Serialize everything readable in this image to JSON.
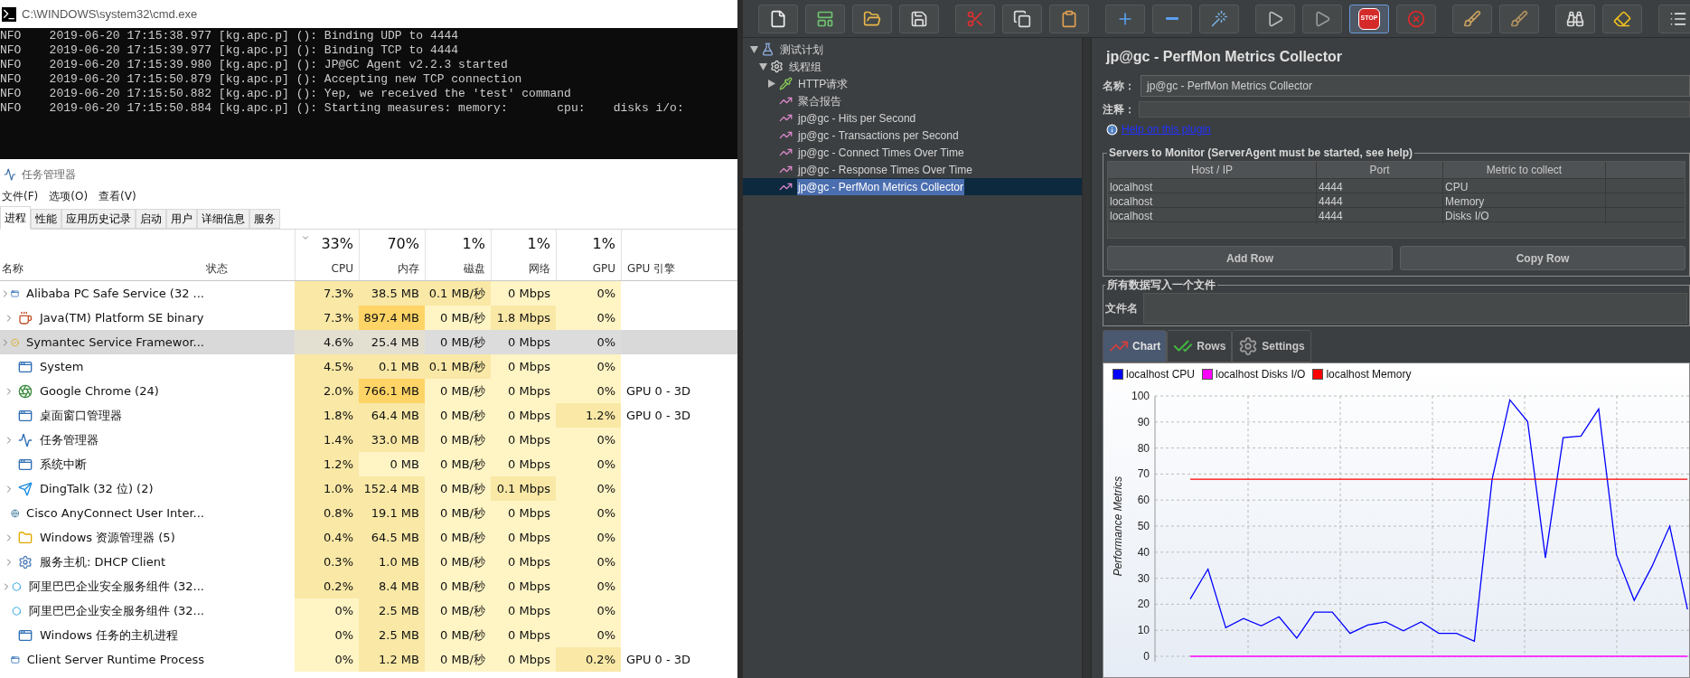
{
  "cmd": {
    "title": "C:\\WINDOWS\\system32\\cmd.exe",
    "lines": [
      "NFO    2019-06-20 17:15:38.977 [kg.apc.p] (): Binding UDP to 4444",
      "NFO    2019-06-20 17:15:39.977 [kg.apc.p] (): Binding TCP to 4444",
      "NFO    2019-06-20 17:15:39.980 [kg.apc.p] (): JP@GC Agent v2.2.3 started",
      "NFO    2019-06-20 17:15:50.879 [kg.apc.p] (): Accepting new TCP connection",
      "NFO    2019-06-20 17:15:50.882 [kg.apc.p] (): Yep, we received the 'test' command",
      "NFO    2019-06-20 17:15:50.884 [kg.apc.p] (): Starting measures: memory:       cpu:    disks i/o:"
    ]
  },
  "task_manager": {
    "title": "任务管理器",
    "menu": [
      "文件(F)",
      "选项(O)",
      "查看(V)"
    ],
    "tabs": [
      {
        "label": "进程",
        "selected": true
      },
      {
        "label": "性能",
        "selected": false
      },
      {
        "label": "应用历史记录",
        "selected": false
      },
      {
        "label": "启动",
        "selected": false
      },
      {
        "label": "用户",
        "selected": false
      },
      {
        "label": "详细信息",
        "selected": false
      },
      {
        "label": "服务",
        "selected": false
      }
    ],
    "columns": [
      {
        "kind": "text",
        "label": "名称"
      },
      {
        "kind": "text",
        "label": "状态"
      },
      {
        "kind": "metric",
        "label": "CPU",
        "total": "33%",
        "sorted": true
      },
      {
        "kind": "metric",
        "label": "内存",
        "total": "70%",
        "sorted": false
      },
      {
        "kind": "metric",
        "label": "磁盘",
        "total": "1%",
        "sorted": false
      },
      {
        "kind": "metric",
        "label": "网络",
        "total": "1%",
        "sorted": false
      },
      {
        "kind": "metric",
        "label": "GPU",
        "total": "1%",
        "sorted": false
      },
      {
        "kind": "text",
        "label": "GPU 引擎"
      }
    ],
    "rows": [
      {
        "kind": "window",
        "expandable": true,
        "selected": false,
        "cells": [
          {
            "text": "Alibaba PC Safe Service (32 ..."
          },
          {
            "text": ""
          },
          {
            "text": "7.3%",
            "color": "#f9e8a6"
          },
          {
            "text": "38.5 MB",
            "color": "#f9e8a6"
          },
          {
            "text": "0.1 MB/秒",
            "color": "#f9e8a6"
          },
          {
            "text": "0 Mbps",
            "color": "#fff4c4"
          },
          {
            "text": "0%",
            "color": "#fff4c4"
          },
          {
            "text": ""
          }
        ]
      },
      {
        "kind": "java",
        "expandable": true,
        "selected": false,
        "cells": [
          {
            "text": "Java(TM) Platform SE binary"
          },
          {
            "text": ""
          },
          {
            "text": "7.3%",
            "color": "#f9e8a6"
          },
          {
            "text": "897.4 MB",
            "color": "#ffd466"
          },
          {
            "text": "0 MB/秒",
            "color": "#fff4c4"
          },
          {
            "text": "1.8 Mbps",
            "color": "#f9e8a6"
          },
          {
            "text": "0%",
            "color": "#fff4c4"
          },
          {
            "text": ""
          }
        ]
      },
      {
        "kind": "check",
        "expandable": true,
        "selected": true,
        "cells": [
          {
            "text": "Symantec Service Framewor..."
          },
          {
            "text": ""
          },
          {
            "text": "4.6%",
            "color": "#e3e0d2"
          },
          {
            "text": "25.4 MB",
            "color": "#e3e0d2"
          },
          {
            "text": "0 MB/秒",
            "color": "#dcdcdc"
          },
          {
            "text": "0 Mbps",
            "color": "#dcdcdc"
          },
          {
            "text": "0%",
            "color": "#dcdcdc"
          },
          {
            "text": ""
          }
        ]
      },
      {
        "kind": "window",
        "expandable": false,
        "selected": false,
        "cells": [
          {
            "text": "System"
          },
          {
            "text": ""
          },
          {
            "text": "4.5%",
            "color": "#f9e8a6"
          },
          {
            "text": "0.1 MB",
            "color": "#f9e8a6"
          },
          {
            "text": "0.1 MB/秒",
            "color": "#f9e8a6"
          },
          {
            "text": "0 Mbps",
            "color": "#fff4c4"
          },
          {
            "text": "0%",
            "color": "#fff4c4"
          },
          {
            "text": ""
          }
        ]
      },
      {
        "kind": "chrome",
        "expandable": true,
        "selected": false,
        "cells": [
          {
            "text": "Google Chrome (24)"
          },
          {
            "text": ""
          },
          {
            "text": "2.0%",
            "color": "#f9e8a6"
          },
          {
            "text": "766.1 MB",
            "color": "#ffd466"
          },
          {
            "text": "0 MB/秒",
            "color": "#fff4c4"
          },
          {
            "text": "0 Mbps",
            "color": "#fff4c4"
          },
          {
            "text": "0%",
            "color": "#fff4c4"
          },
          {
            "text": "GPU 0 - 3D"
          }
        ]
      },
      {
        "kind": "window",
        "expandable": false,
        "selected": false,
        "cells": [
          {
            "text": "桌面窗口管理器"
          },
          {
            "text": ""
          },
          {
            "text": "1.8%",
            "color": "#f9e8a6"
          },
          {
            "text": "64.4 MB",
            "color": "#f9e8a6"
          },
          {
            "text": "0 MB/秒",
            "color": "#fff4c4"
          },
          {
            "text": "0 Mbps",
            "color": "#fff4c4"
          },
          {
            "text": "1.2%",
            "color": "#f9e8a6"
          },
          {
            "text": "GPU 0 - 3D"
          }
        ]
      },
      {
        "kind": "monitor",
        "expandable": true,
        "selected": false,
        "cells": [
          {
            "text": "任务管理器"
          },
          {
            "text": ""
          },
          {
            "text": "1.4%",
            "color": "#f9e8a6"
          },
          {
            "text": "33.0 MB",
            "color": "#f9e8a6"
          },
          {
            "text": "0 MB/秒",
            "color": "#fff4c4"
          },
          {
            "text": "0 Mbps",
            "color": "#fff4c4"
          },
          {
            "text": "0%",
            "color": "#fff4c4"
          },
          {
            "text": ""
          }
        ]
      },
      {
        "kind": "window",
        "expandable": false,
        "selected": false,
        "cells": [
          {
            "text": "系统中断"
          },
          {
            "text": ""
          },
          {
            "text": "1.2%",
            "color": "#f9e8a6"
          },
          {
            "text": "0 MB",
            "color": "#fff4c4"
          },
          {
            "text": "0 MB/秒",
            "color": "#fff4c4"
          },
          {
            "text": "0 Mbps",
            "color": "#fff4c4"
          },
          {
            "text": "0%",
            "color": "#fff4c4"
          },
          {
            "text": ""
          }
        ]
      },
      {
        "kind": "bird",
        "expandable": true,
        "selected": false,
        "cells": [
          {
            "text": "DingTalk (32 位) (2)"
          },
          {
            "text": ""
          },
          {
            "text": "1.0%",
            "color": "#f9e8a6"
          },
          {
            "text": "152.4 MB",
            "color": "#f9e8a6"
          },
          {
            "text": "0 MB/秒",
            "color": "#fff4c4"
          },
          {
            "text": "0.1 Mbps",
            "color": "#f9e8a6"
          },
          {
            "text": "0%",
            "color": "#fff4c4"
          },
          {
            "text": ""
          }
        ]
      },
      {
        "kind": "globe",
        "expandable": false,
        "selected": false,
        "cells": [
          {
            "text": "Cisco AnyConnect User Inter..."
          },
          {
            "text": ""
          },
          {
            "text": "0.8%",
            "color": "#f9e8a6"
          },
          {
            "text": "19.1 MB",
            "color": "#f9e8a6"
          },
          {
            "text": "0 MB/秒",
            "color": "#fff4c4"
          },
          {
            "text": "0 Mbps",
            "color": "#fff4c4"
          },
          {
            "text": "0%",
            "color": "#fff4c4"
          },
          {
            "text": ""
          }
        ]
      },
      {
        "kind": "folder",
        "expandable": true,
        "selected": false,
        "cells": [
          {
            "text": "Windows 资源管理器 (5)"
          },
          {
            "text": ""
          },
          {
            "text": "0.4%",
            "color": "#f9e8a6"
          },
          {
            "text": "64.5 MB",
            "color": "#f9e8a6"
          },
          {
            "text": "0 MB/秒",
            "color": "#fff4c4"
          },
          {
            "text": "0 Mbps",
            "color": "#fff4c4"
          },
          {
            "text": "0%",
            "color": "#fff4c4"
          },
          {
            "text": ""
          }
        ]
      },
      {
        "kind": "gear",
        "expandable": true,
        "selected": false,
        "cells": [
          {
            "text": "服务主机: DHCP Client"
          },
          {
            "text": ""
          },
          {
            "text": "0.3%",
            "color": "#f9e8a6"
          },
          {
            "text": "1.0 MB",
            "color": "#f9e8a6"
          },
          {
            "text": "0 MB/秒",
            "color": "#fff4c4"
          },
          {
            "text": "0 Mbps",
            "color": "#fff4c4"
          },
          {
            "text": "0%",
            "color": "#fff4c4"
          },
          {
            "text": ""
          }
        ]
      },
      {
        "kind": "hexagon",
        "expandable": true,
        "selected": false,
        "cells": [
          {
            "text": "阿里巴巴企业安全服务组件 (32..."
          },
          {
            "text": ""
          },
          {
            "text": "0.2%",
            "color": "#f9e8a6"
          },
          {
            "text": "8.4 MB",
            "color": "#f9e8a6"
          },
          {
            "text": "0 MB/秒",
            "color": "#fff4c4"
          },
          {
            "text": "0 Mbps",
            "color": "#fff4c4"
          },
          {
            "text": "0%",
            "color": "#fff4c4"
          },
          {
            "text": ""
          }
        ]
      },
      {
        "kind": "hexagon",
        "expandable": false,
        "selected": false,
        "cells": [
          {
            "text": "阿里巴巴企业安全服务组件 (32..."
          },
          {
            "text": ""
          },
          {
            "text": "0%",
            "color": "#fff4c4"
          },
          {
            "text": "2.5 MB",
            "color": "#f9e8a6"
          },
          {
            "text": "0 MB/秒",
            "color": "#fff4c4"
          },
          {
            "text": "0 Mbps",
            "color": "#fff4c4"
          },
          {
            "text": "0%",
            "color": "#fff4c4"
          },
          {
            "text": ""
          }
        ]
      },
      {
        "kind": "window",
        "expandable": false,
        "selected": false,
        "cells": [
          {
            "text": "Windows 任务的主机进程"
          },
          {
            "text": ""
          },
          {
            "text": "0%",
            "color": "#fff4c4"
          },
          {
            "text": "2.5 MB",
            "color": "#f9e8a6"
          },
          {
            "text": "0 MB/秒",
            "color": "#fff4c4"
          },
          {
            "text": "0 Mbps",
            "color": "#fff4c4"
          },
          {
            "text": "0%",
            "color": "#fff4c4"
          },
          {
            "text": ""
          }
        ]
      },
      {
        "kind": "window",
        "expandable": false,
        "selected": false,
        "cells": [
          {
            "text": "Client Server Runtime Process"
          },
          {
            "text": ""
          },
          {
            "text": "0%",
            "color": "#fff4c4"
          },
          {
            "text": "1.2 MB",
            "color": "#f9e8a6"
          },
          {
            "text": "0 MB/秒",
            "color": "#fff4c4"
          },
          {
            "text": "0 Mbps",
            "color": "#fff4c4"
          },
          {
            "text": "0.2%",
            "color": "#f9e8a6"
          },
          {
            "text": "GPU 0 - 3D"
          }
        ]
      }
    ]
  },
  "jmeter": {
    "toolbar": [
      [
        {
          "kind": "new",
          "highlighted": false
        },
        {
          "kind": "templates",
          "highlighted": false
        },
        {
          "kind": "open",
          "highlighted": false
        },
        {
          "kind": "save",
          "highlighted": false
        }
      ],
      [
        {
          "kind": "cut",
          "highlighted": false
        },
        {
          "kind": "copy",
          "highlighted": false
        },
        {
          "kind": "paste",
          "highlighted": false
        }
      ],
      [
        {
          "kind": "expand",
          "highlighted": false
        },
        {
          "kind": "collapse",
          "highlighted": false
        },
        {
          "kind": "toggle",
          "highlighted": false
        }
      ],
      [
        {
          "kind": "start",
          "highlighted": false
        },
        {
          "kind": "start_no_pause",
          "highlighted": false
        },
        {
          "kind": "stop",
          "label": "STOP",
          "highlighted": true
        },
        {
          "kind": "shutdown",
          "highlighted": false
        }
      ],
      [
        {
          "kind": "clear",
          "highlighted": false
        },
        {
          "kind": "clear_all",
          "highlighted": false
        }
      ],
      [
        {
          "kind": "search",
          "highlighted": false
        },
        {
          "kind": "reset_search",
          "highlighted": false
        }
      ],
      [
        {
          "kind": "functions",
          "highlighted": false
        }
      ]
    ],
    "tree": [
      {
        "label": "测试计划",
        "kind": "plan",
        "expanded": true,
        "selected": false,
        "children": [
          {
            "label": "线程组",
            "kind": "threads",
            "expanded": true,
            "selected": false,
            "children": [
              {
                "label": "HTTP请求",
                "kind": "sampler",
                "expanded": false,
                "selected": false
              },
              {
                "label": "聚合报告",
                "kind": "listener",
                "selected": false
              },
              {
                "label": "jp@gc - Hits per Second",
                "kind": "listener",
                "selected": false
              },
              {
                "label": "jp@gc - Transactions per Second",
                "kind": "listener",
                "selected": false
              },
              {
                "label": "jp@gc - Connect Times Over Time",
                "kind": "listener",
                "selected": false
              },
              {
                "label": "jp@gc - Response Times Over Time",
                "kind": "listener",
                "selected": false
              },
              {
                "label": "jp@gc - PerfMon Metrics Collector",
                "kind": "listener",
                "selected": true
              }
            ]
          }
        ]
      }
    ],
    "title": "jp@gc - PerfMon Metrics Collector",
    "name_label": "名称：",
    "name_value": "jp@gc - PerfMon Metrics Collector",
    "comment_label": "注释：",
    "help_link": "Help on this plugin",
    "servers": {
      "legend": "Servers to Monitor (ServerAgent must be started, see help)",
      "columns": [
        "Host / IP",
        "Port",
        "Metric to collect"
      ],
      "rows": [
        [
          "localhost",
          "4444",
          "CPU"
        ],
        [
          "localhost",
          "4444",
          "Memory"
        ],
        [
          "localhost",
          "4444",
          "Disks I/O"
        ]
      ],
      "buttons": [
        "Add Row",
        "Copy Row"
      ]
    },
    "file": {
      "legend": "所有数据写入一个文件",
      "label": "文件名"
    },
    "chart_tabs": [
      {
        "label": "Chart",
        "kind": "chart",
        "selected": true
      },
      {
        "label": "Rows",
        "kind": "checks",
        "selected": false
      },
      {
        "label": "Settings",
        "kind": "gear",
        "selected": false
      }
    ],
    "chart_data": {
      "type": "line",
      "ylabel": "Performance Metrics",
      "ylim": [
        0,
        100
      ],
      "yticks": [
        0,
        10,
        20,
        30,
        40,
        50,
        60,
        70,
        80,
        90,
        100
      ],
      "grid": true,
      "legend": "top",
      "series": [
        {
          "name": "localhost CPU",
          "color": "#0000ff",
          "values": [
            22,
            33.5,
            11,
            14.5,
            11.7,
            15.2,
            7,
            17,
            17,
            8.8,
            12,
            13.2,
            9.8,
            13.2,
            8.8,
            8.8,
            5.8,
            68,
            98.5,
            90.2,
            37.8,
            84,
            84.6,
            95,
            39,
            21.5,
            34.5,
            50,
            18
          ]
        },
        {
          "name": "localhost Disks I/O",
          "color": "#ff00ff",
          "values": [
            0,
            0,
            0,
            0,
            0,
            0,
            0,
            0,
            0,
            0,
            0,
            0,
            0,
            0,
            0,
            0,
            0,
            0,
            0,
            0,
            0,
            0,
            0,
            0,
            0,
            0,
            0,
            0,
            0
          ]
        },
        {
          "name": "localhost Memory",
          "color": "#ff0000",
          "values": [
            68,
            68,
            68,
            68,
            68,
            68,
            68,
            68,
            68,
            68,
            68,
            68,
            68,
            68,
            68,
            68,
            68,
            68,
            68,
            68,
            68,
            68,
            68,
            68,
            68,
            68,
            68,
            68,
            68
          ]
        }
      ]
    }
  }
}
